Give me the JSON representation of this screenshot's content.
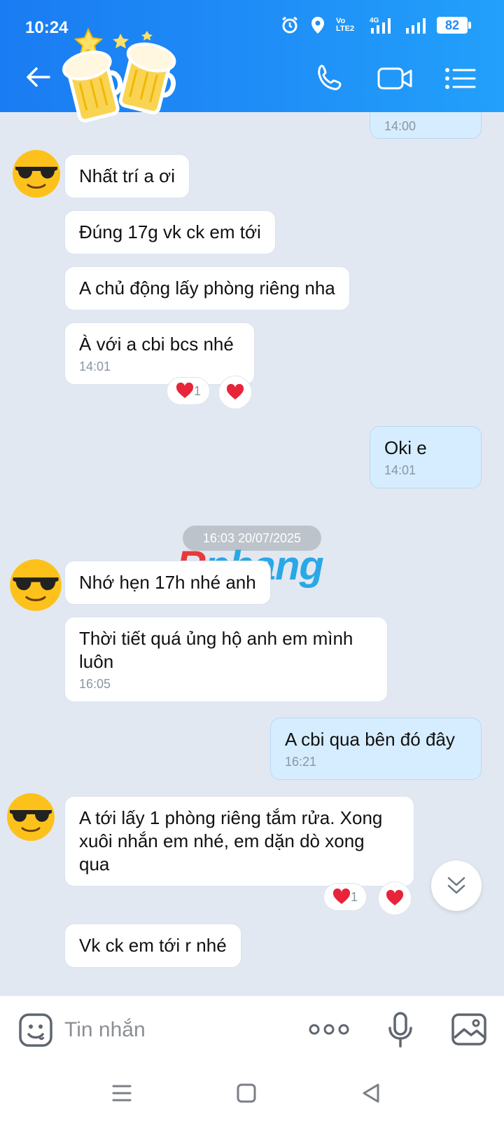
{
  "status_bar": {
    "time": "10:24",
    "battery": "82",
    "network": "4G",
    "volte": "Vo LTE2"
  },
  "header": {
    "back_icon": "arrow-left-icon",
    "sticker": "beer-cheers-sticker",
    "call_icon": "phone-icon",
    "video_icon": "video-camera-icon",
    "menu_icon": "list-menu-icon"
  },
  "messages": [
    {
      "dir": "out",
      "time": "14:00"
    },
    {
      "dir": "in",
      "text": "Nhất trí a ơi"
    },
    {
      "dir": "in",
      "text": "Đúng 17g vk ck em tới"
    },
    {
      "dir": "in",
      "text": "A chủ động lấy phòng riêng nha"
    },
    {
      "dir": "in",
      "text": "À với a cbi bcs nhé",
      "time": "14:01",
      "reaction_count": "1"
    },
    {
      "dir": "out",
      "text": "Oki e",
      "time": "14:01"
    },
    {
      "dir": "in",
      "text": "Nhớ hẹn 17h nhé anh"
    },
    {
      "dir": "in",
      "text": "Thời tiết quá ủng hộ anh em mình luôn",
      "time": "16:05"
    },
    {
      "dir": "out",
      "text": "A cbi qua bên đó đây",
      "time": "16:21"
    },
    {
      "dir": "in",
      "text": "A tới lấy 1 phòng riêng tắm rửa. Xong xuôi nhắn em nhé, em dặn dò xong qua",
      "reaction_count": "1"
    },
    {
      "dir": "in",
      "text": "Vk ck em tới r nhé"
    }
  ],
  "date_separator": "16:03 20/07/2025",
  "watermark": {
    "first": "R",
    "rest": "phang"
  },
  "input": {
    "placeholder": "Tin nhắn"
  },
  "colors": {
    "header": "#1e8bf6",
    "incoming": "#ffffff",
    "outgoing": "#d6edff",
    "background": "#e2e8f1",
    "heart": "#e8243a"
  }
}
